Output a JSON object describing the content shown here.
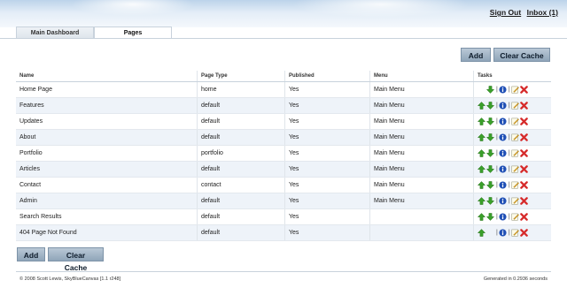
{
  "header": {
    "sign_out": "Sign Out",
    "inbox": "Inbox (1)"
  },
  "tabs": [
    {
      "label": "Main Dashboard",
      "active": false
    },
    {
      "label": "Pages",
      "active": true
    }
  ],
  "toolbar": {
    "add_label": "Add",
    "clear_cache_label": "Clear Cache"
  },
  "table": {
    "columns": [
      "Name",
      "Page Type",
      "Published",
      "Menu",
      "Tasks"
    ],
    "rows": [
      {
        "name": "Home Page",
        "type": "home",
        "published": "Yes",
        "menu": "Main Menu",
        "up": false,
        "down": true
      },
      {
        "name": "Features",
        "type": "default",
        "published": "Yes",
        "menu": "Main Menu",
        "up": true,
        "down": true
      },
      {
        "name": "Updates",
        "type": "default",
        "published": "Yes",
        "menu": "Main Menu",
        "up": true,
        "down": true
      },
      {
        "name": "About",
        "type": "default",
        "published": "Yes",
        "menu": "Main Menu",
        "up": true,
        "down": true
      },
      {
        "name": "Portfolio",
        "type": "portfolio",
        "published": "Yes",
        "menu": "Main Menu",
        "up": true,
        "down": true
      },
      {
        "name": "Articles",
        "type": "default",
        "published": "Yes",
        "menu": "Main Menu",
        "up": true,
        "down": true
      },
      {
        "name": "Contact",
        "type": "contact",
        "published": "Yes",
        "menu": "Main Menu",
        "up": true,
        "down": true
      },
      {
        "name": "Admin",
        "type": "default",
        "published": "Yes",
        "menu": "Main Menu",
        "up": true,
        "down": true
      },
      {
        "name": "Search Results",
        "type": "default",
        "published": "Yes",
        "menu": "",
        "up": true,
        "down": true
      },
      {
        "name": "404 Page Not Found",
        "type": "default",
        "published": "Yes",
        "menu": "",
        "up": true,
        "down": false
      }
    ]
  },
  "icons": {
    "up": "arrow-up-icon",
    "down": "arrow-down-icon",
    "info": "info-icon",
    "edit": "edit-icon",
    "delete": "delete-icon"
  },
  "colors": {
    "up_arrow": "#3aa02a",
    "info": "#1f4fb5",
    "delete": "#d62b2b",
    "edit": "#e8a317"
  },
  "footer": {
    "left": "© 2008 Scott Lewis, SkyBlueCanvas [1.1 r248]",
    "right": "Generated in 0.2936 seconds"
  }
}
